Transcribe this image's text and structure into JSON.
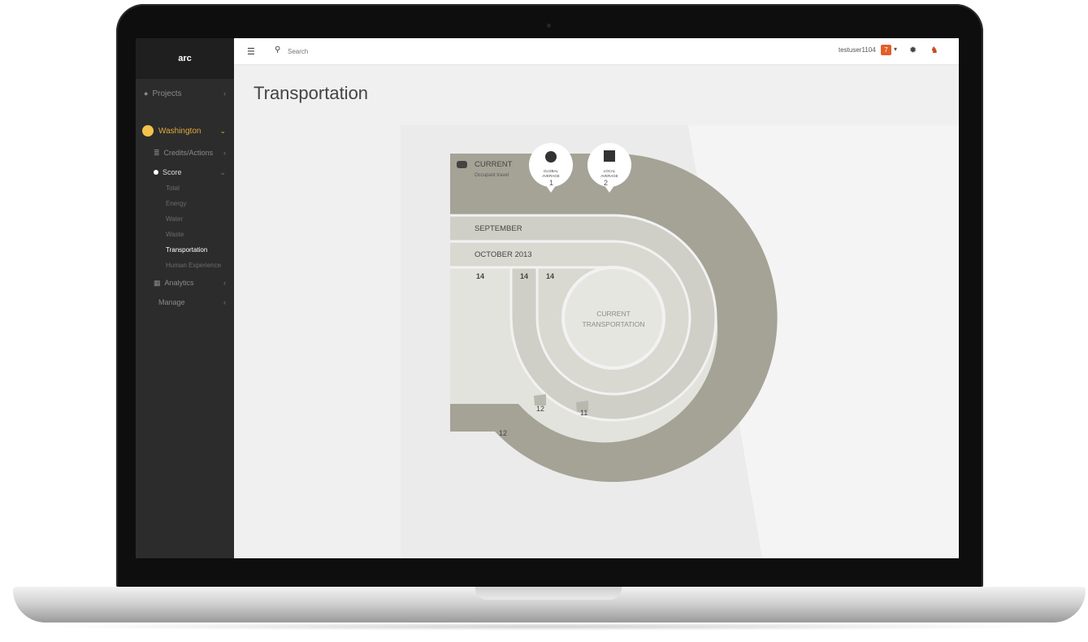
{
  "app": {
    "brand": "arc"
  },
  "sidebar": {
    "projects_label": "Projects",
    "project_name": "Washington",
    "credits_label": "Credits/Actions",
    "score_label": "Score",
    "score_items": [
      {
        "label": "Total"
      },
      {
        "label": "Energy"
      },
      {
        "label": "Water"
      },
      {
        "label": "Waste"
      },
      {
        "label": "Transportation",
        "active": true
      },
      {
        "label": "Human Experience"
      }
    ],
    "analytics_label": "Analytics",
    "manage_label": "Manage"
  },
  "topbar": {
    "search_placeholder": "Search",
    "username": "testuser1104",
    "notification_count": "7"
  },
  "page": {
    "title": "Transportation"
  },
  "colors": {
    "ring_dark": "#a4a396",
    "ring_light": "#d6d6cf",
    "accent": "#e0a93a"
  },
  "chart_data": {
    "type": "radial-bar",
    "markers": [
      {
        "label_line1": "GLOBAL",
        "label_line2": "AVERAGE",
        "icon": "globe-icon"
      },
      {
        "label_line1": "LOCAL",
        "label_line2": "AVERAGE",
        "icon": "building-icon"
      }
    ],
    "center_label_line1": "CURRENT",
    "center_label_line2": "TRANSPORTATION",
    "series": [
      {
        "name": "CURRENT",
        "subtitle": "Occupant travel",
        "value": 12,
        "ticks": [
          1,
          2
        ]
      },
      {
        "name": "SEPTEMBER",
        "value": 12
      },
      {
        "name": "OCTOBER 2013",
        "value": 11
      }
    ],
    "value_labels": [
      "14",
      "14",
      "14",
      "12",
      "12",
      "11"
    ]
  }
}
